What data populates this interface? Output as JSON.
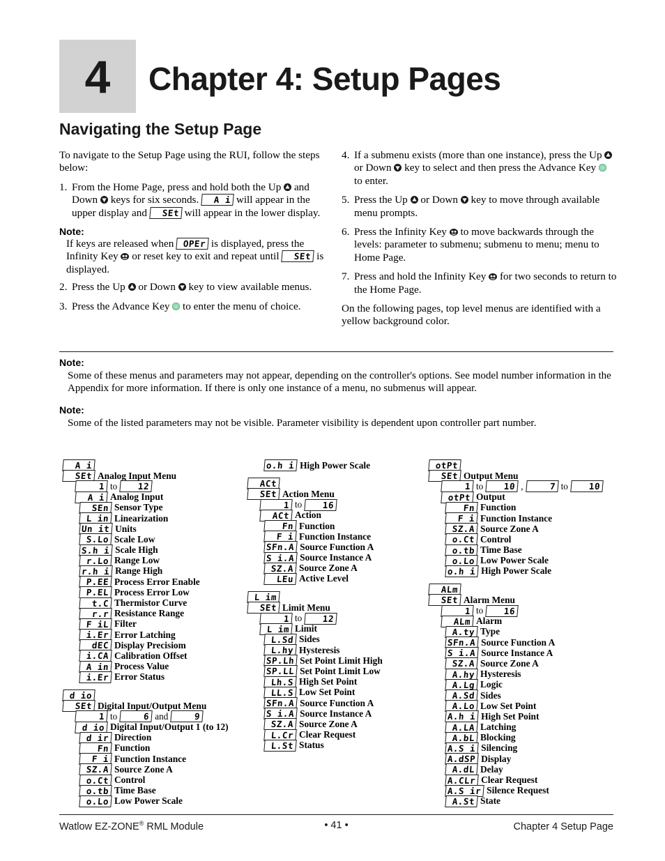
{
  "header": {
    "chapter_number": "4",
    "chapter_title": "Chapter 4: Setup Pages",
    "section_title": "Navigating the Setup Page"
  },
  "intro": {
    "lead": "To navigate to the Setup Page using the RUI, follow the steps below:"
  },
  "steps_left": {
    "s1_num": "1.",
    "s1_a": "From the Home Page, press and hold both the Up",
    "s1_b": "and Down",
    "s1_c": "keys for six seconds.",
    "s1_chip1": "A i",
    "s1_d": "will appear in the upper display and",
    "s1_chip2": "SEt",
    "s1_e": "will appear in the lower display.",
    "note_label": "Note:",
    "note_a": "If keys are released when",
    "note_chip": "OPEr",
    "note_b": "is displayed, press the Infinity Key",
    "note_c": "or reset key to exit and repeat until",
    "note_chip2": "SEt",
    "note_d": "is displayed.",
    "s2_num": "2.",
    "s2_a": "Press the Up",
    "s2_b": "or Down",
    "s2_c": "key to view available menus.",
    "s3_num": "3.",
    "s3_a": "Press the Advance Key",
    "s3_b": "to enter the menu of choice."
  },
  "steps_right": {
    "s4_num": "4.",
    "s4_a": "If a submenu exists (more than one instance), press the Up",
    "s4_b": "or Down",
    "s4_c": "key to select and then press the Advance Key",
    "s4_d": "to enter.",
    "s5_num": "5.",
    "s5_a": "Press the Up",
    "s5_b": "or Down",
    "s5_c": "key to move through available menu prompts.",
    "s6_num": "6.",
    "s6_a": "Press the Infinity Key",
    "s6_b": "to move backwards through the levels: parameter to submenu; submenu to menu; menu to Home Page.",
    "s7_num": "7.",
    "s7_a": "Press and hold the Infinity Key",
    "s7_b": "for two seconds to return to the Home Page.",
    "closing": "On the following pages, top level menus are identified with a yellow background color."
  },
  "notes": [
    {
      "label": "Note:",
      "text": "Some of these menus and parameters may not appear, depending on the controller's options. See model number information in the Appendix for more information. If there is only one instance of a menu, no submenus will appear."
    },
    {
      "label": "Note:",
      "text": "Some of the listed parameters may not be visible. Parameter visibility is dependent upon controller part number."
    }
  ],
  "tree_column_1": [
    {
      "type": "code_only",
      "indent": 0,
      "code": "A i"
    },
    {
      "type": "code_label",
      "indent": 0,
      "code": "SEt",
      "label": "Analog Input Menu"
    },
    {
      "type": "range",
      "indent": 1,
      "from": "1",
      "to_word": "to",
      "to": "12"
    },
    {
      "type": "code_label",
      "indent": 1,
      "code": "A i",
      "label": "Analog Input"
    },
    {
      "type": "code_label",
      "indent": 2,
      "code": "SEn",
      "label": "Sensor Type"
    },
    {
      "type": "code_label",
      "indent": 2,
      "code": "L in",
      "label": "Linearization"
    },
    {
      "type": "code_label",
      "indent": 2,
      "code": "Un it",
      "label": "Units"
    },
    {
      "type": "code_label",
      "indent": 2,
      "code": "S.Lo",
      "label": "Scale Low"
    },
    {
      "type": "code_label",
      "indent": 2,
      "code": "S.h i",
      "label": "Scale High"
    },
    {
      "type": "code_label",
      "indent": 2,
      "code": "r.Lo",
      "label": "Range Low"
    },
    {
      "type": "code_label",
      "indent": 2,
      "code": "r.h i",
      "label": "Range High"
    },
    {
      "type": "code_label",
      "indent": 2,
      "code": "P.EE",
      "label": "Process Error Enable"
    },
    {
      "type": "code_label",
      "indent": 2,
      "code": "P.EL",
      "label": "Process Error Low"
    },
    {
      "type": "code_label",
      "indent": 2,
      "code": "t.C",
      "label": "Thermistor Curve"
    },
    {
      "type": "code_label",
      "indent": 2,
      "code": "r.r",
      "label": "Resistance Range"
    },
    {
      "type": "code_label",
      "indent": 2,
      "code": "F iL",
      "label": "Filter"
    },
    {
      "type": "code_label",
      "indent": 2,
      "code": "i.Er",
      "label": "Error Latching"
    },
    {
      "type": "code_label",
      "indent": 2,
      "code": "dEC",
      "label": "Display Precisiom"
    },
    {
      "type": "code_label",
      "indent": 2,
      "code": "i.CA",
      "label": "Calibration Offset"
    },
    {
      "type": "code_label",
      "indent": 2,
      "code": "A in",
      "label": "Process Value"
    },
    {
      "type": "code_label",
      "indent": 2,
      "code": "i.Er",
      "label": "Error Status"
    },
    {
      "type": "spacer"
    },
    {
      "type": "code_only",
      "indent": 0,
      "code": "d io"
    },
    {
      "type": "code_label",
      "indent": 0,
      "code": "SEt",
      "label": "Digital Input/Output Menu"
    },
    {
      "type": "range2",
      "indent": 1,
      "from": "1",
      "to_word": "to",
      "to": "6",
      "and_word": "and",
      "extra": "9"
    },
    {
      "type": "code_label",
      "indent": 1,
      "code": "d io",
      "label": "Digital Input/Output 1 (to 12)"
    },
    {
      "type": "code_label",
      "indent": 2,
      "code": "d ir",
      "label": "Direction"
    },
    {
      "type": "code_label",
      "indent": 2,
      "code": "Fn",
      "label": "Function"
    },
    {
      "type": "code_label",
      "indent": 2,
      "code": "F i",
      "label": "Function Instance"
    },
    {
      "type": "code_label",
      "indent": 2,
      "code": "SZ.A",
      "label": "Source Zone A"
    },
    {
      "type": "code_label",
      "indent": 2,
      "code": "o.Ct",
      "label": "Control"
    },
    {
      "type": "code_label",
      "indent": 2,
      "code": "o.tb",
      "label": "Time Base"
    },
    {
      "type": "code_label",
      "indent": 2,
      "code": "o.Lo",
      "label": "Low Power Scale"
    }
  ],
  "tree_column_2": [
    {
      "type": "code_label",
      "indent": 2,
      "code": "o.h i",
      "label": "High Power Scale"
    },
    {
      "type": "spacer"
    },
    {
      "type": "code_only",
      "indent": 0,
      "code": "ACt"
    },
    {
      "type": "code_label",
      "indent": 0,
      "code": "SEt",
      "label": "Action Menu"
    },
    {
      "type": "range",
      "indent": 1,
      "from": "1",
      "to_word": "to",
      "to": "16"
    },
    {
      "type": "code_label",
      "indent": 1,
      "code": "ACt",
      "label": "Action"
    },
    {
      "type": "code_label",
      "indent": 2,
      "code": "Fn",
      "label": "Function"
    },
    {
      "type": "code_label",
      "indent": 2,
      "code": "F i",
      "label": "Function Instance"
    },
    {
      "type": "code_label",
      "indent": 2,
      "code": "SFn.A",
      "label": "Source Function A"
    },
    {
      "type": "code_label",
      "indent": 2,
      "code": "S i.A",
      "label": "Source Instance A"
    },
    {
      "type": "code_label",
      "indent": 2,
      "code": "SZ.A",
      "label": "Source Zone A"
    },
    {
      "type": "code_label",
      "indent": 2,
      "code": "LEu",
      "label": "Active Level"
    },
    {
      "type": "spacer"
    },
    {
      "type": "code_only",
      "indent": 0,
      "code": "L im"
    },
    {
      "type": "code_label",
      "indent": 0,
      "code": "SEt",
      "label": "Limit Menu"
    },
    {
      "type": "range",
      "indent": 1,
      "from": "1",
      "to_word": "to",
      "to": "12"
    },
    {
      "type": "code_label",
      "indent": 1,
      "code": "L im",
      "label": "Limit"
    },
    {
      "type": "code_label",
      "indent": 2,
      "code": "L.Sd",
      "label": "Sides"
    },
    {
      "type": "code_label",
      "indent": 2,
      "code": "L.hy",
      "label": "Hysteresis"
    },
    {
      "type": "code_label",
      "indent": 2,
      "code": "SP.Lh",
      "label": "Set Point Limit High"
    },
    {
      "type": "code_label",
      "indent": 2,
      "code": "SP.LL",
      "label": "Set Point Limit Low"
    },
    {
      "type": "code_label",
      "indent": 2,
      "code": "Lh.S",
      "label": "High Set Point"
    },
    {
      "type": "code_label",
      "indent": 2,
      "code": "LL.S",
      "label": "Low Set Point"
    },
    {
      "type": "code_label",
      "indent": 2,
      "code": "SFn.A",
      "label": "Source Function A"
    },
    {
      "type": "code_label",
      "indent": 2,
      "code": "S i.A",
      "label": "Source Instance A"
    },
    {
      "type": "code_label",
      "indent": 2,
      "code": "SZ.A",
      "label": "Source Zone A"
    },
    {
      "type": "code_label",
      "indent": 2,
      "code": "L.Cr",
      "label": "Clear Request"
    },
    {
      "type": "code_label",
      "indent": 2,
      "code": "L.St",
      "label": "Status"
    }
  ],
  "tree_column_3": [
    {
      "type": "code_only",
      "indent": 0,
      "code": "otPt"
    },
    {
      "type": "code_label",
      "indent": 0,
      "code": "SEt",
      "label": "Output Menu"
    },
    {
      "type": "range4",
      "indent": 1,
      "from": "1",
      "to_word": "to",
      "to": "10",
      "comma": ",",
      "from2": "7",
      "to_word2": "to",
      "to2": "10"
    },
    {
      "type": "code_label",
      "indent": 1,
      "code": "otPt",
      "label": "Output"
    },
    {
      "type": "code_label",
      "indent": 2,
      "code": "Fn",
      "label": "Function"
    },
    {
      "type": "code_label",
      "indent": 2,
      "code": "F i",
      "label": "Function Instance"
    },
    {
      "type": "code_label",
      "indent": 2,
      "code": "SZ.A",
      "label": "Source Zone A"
    },
    {
      "type": "code_label",
      "indent": 2,
      "code": "o.Ct",
      "label": "Control"
    },
    {
      "type": "code_label",
      "indent": 2,
      "code": "o.tb",
      "label": "Time Base"
    },
    {
      "type": "code_label",
      "indent": 2,
      "code": "o.Lo",
      "label": "Low Power Scale"
    },
    {
      "type": "code_label",
      "indent": 2,
      "code": "o.h i",
      "label": "High Power Scale"
    },
    {
      "type": "spacer"
    },
    {
      "type": "code_only",
      "indent": 0,
      "code": "ALm"
    },
    {
      "type": "code_label",
      "indent": 0,
      "code": "SEt",
      "label": "Alarm Menu"
    },
    {
      "type": "range",
      "indent": 1,
      "from": "1",
      "to_word": "to",
      "to": "16"
    },
    {
      "type": "code_label",
      "indent": 1,
      "code": "ALm",
      "label": "Alarm"
    },
    {
      "type": "code_label",
      "indent": 2,
      "code": "A.ty",
      "label": "Type"
    },
    {
      "type": "code_label",
      "indent": 2,
      "code": "SFn.A",
      "label": "Source Function A"
    },
    {
      "type": "code_label",
      "indent": 2,
      "code": "S i.A",
      "label": "Source Instance A"
    },
    {
      "type": "code_label",
      "indent": 2,
      "code": "SZ.A",
      "label": "Source Zone A"
    },
    {
      "type": "code_label",
      "indent": 2,
      "code": "A.hy",
      "label": "Hysteresis"
    },
    {
      "type": "code_label",
      "indent": 2,
      "code": "A.Lg",
      "label": "Logic"
    },
    {
      "type": "code_label",
      "indent": 2,
      "code": "A.Sd",
      "label": "Sides"
    },
    {
      "type": "code_label",
      "indent": 2,
      "code": "A.Lo",
      "label": "Low Set Point"
    },
    {
      "type": "code_label",
      "indent": 2,
      "code": "A.h i",
      "label": "High Set Point"
    },
    {
      "type": "code_label",
      "indent": 2,
      "code": "A.LA",
      "label": "Latching"
    },
    {
      "type": "code_label",
      "indent": 2,
      "code": "A.bL",
      "label": "Blocking"
    },
    {
      "type": "code_label",
      "indent": 2,
      "code": "A.S i",
      "label": "Silencing"
    },
    {
      "type": "code_label",
      "indent": 2,
      "code": "A.dSP",
      "label": "Display"
    },
    {
      "type": "code_label",
      "indent": 2,
      "code": "A.dL",
      "label": "Delay"
    },
    {
      "type": "code_label",
      "indent": 2,
      "code": "A.CLr",
      "label": "Clear Request"
    },
    {
      "type": "code_label",
      "indent": 2,
      "code": "A.S ir",
      "label": "Silence Request"
    },
    {
      "type": "code_label",
      "indent": 2,
      "code": "A.St",
      "label": "State"
    }
  ],
  "footer": {
    "left_a": "Watlow EZ-ZONE",
    "left_reg": "®",
    "left_b": " RML Module",
    "center": "• 41 •",
    "right": "Chapter 4 Setup Page"
  },
  "colors": {
    "chapter_box_bg": "#d2d2d2",
    "text": "#1a1a1a",
    "advance_key_green": "#7fcfa4",
    "infinity_key_black": "#1a1a1a"
  },
  "icons": {
    "up_key": "up-arrow-key-icon",
    "down_key": "down-arrow-key-icon",
    "advance_key": "advance-key-icon",
    "infinity_key": "infinity-key-icon"
  }
}
